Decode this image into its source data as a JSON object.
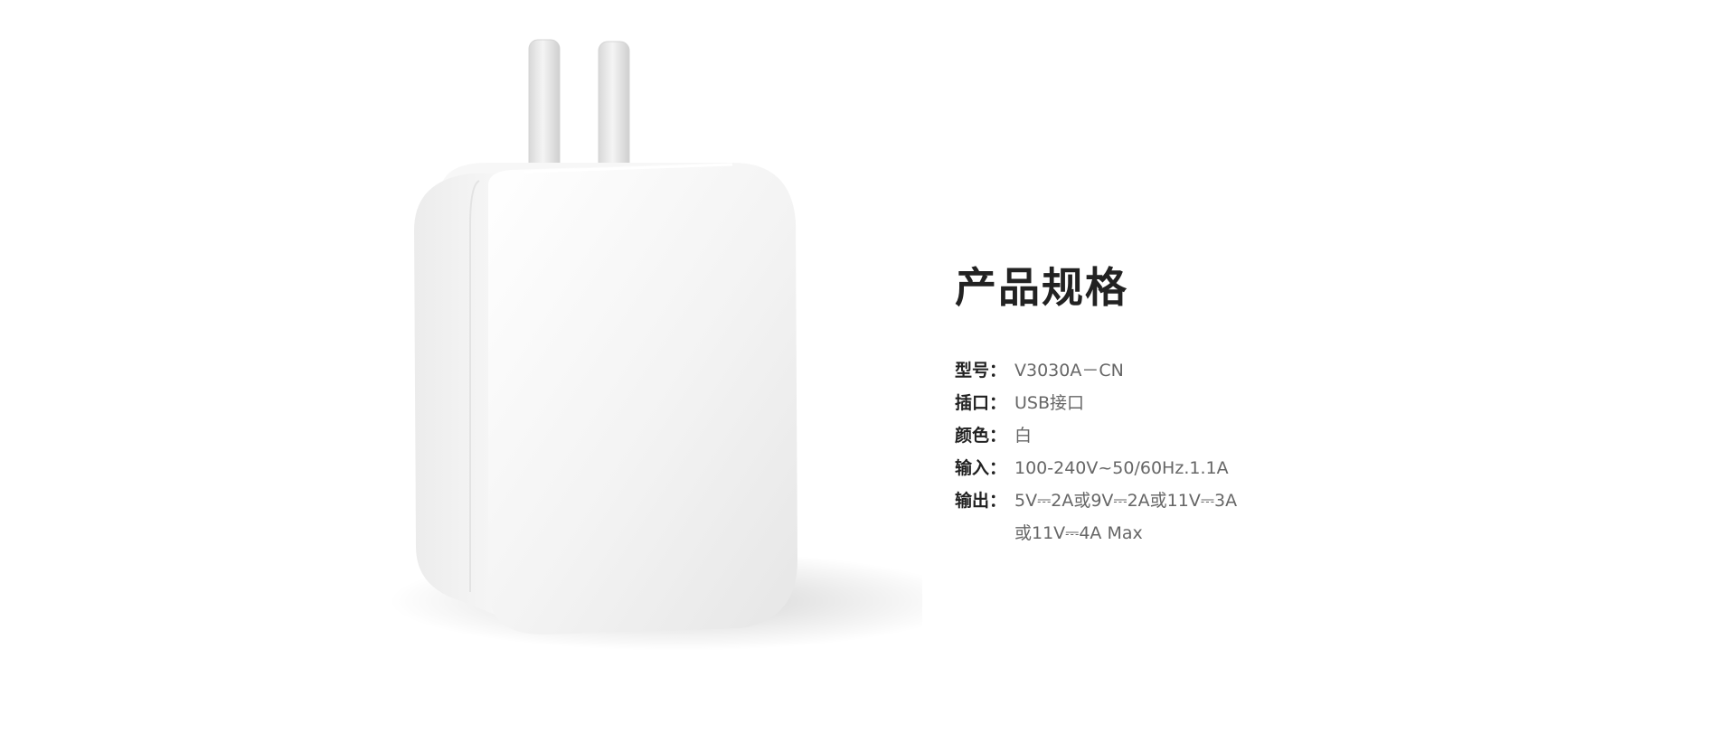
{
  "colors": {
    "background": "#ffffff",
    "title": "#222222",
    "label": "#222222",
    "value": "#666666",
    "product_body": "#f2f2f2"
  },
  "product": {
    "icon": "usb-charger-image"
  },
  "specs": {
    "title": "产品规格",
    "rows": [
      {
        "label": "型号：",
        "values": [
          "V3030A－CN"
        ]
      },
      {
        "label": "插口：",
        "values": [
          "USB接口"
        ]
      },
      {
        "label": "颜色：",
        "values": [
          "白"
        ]
      },
      {
        "label": "输入：",
        "values": [
          "100-240V~50/60Hz.1.1A"
        ]
      },
      {
        "label": "输出：",
        "values": [
          "5V⎓2A或9V⎓2A或11V⎓3A",
          "或11V⎓4A Max"
        ]
      }
    ]
  }
}
